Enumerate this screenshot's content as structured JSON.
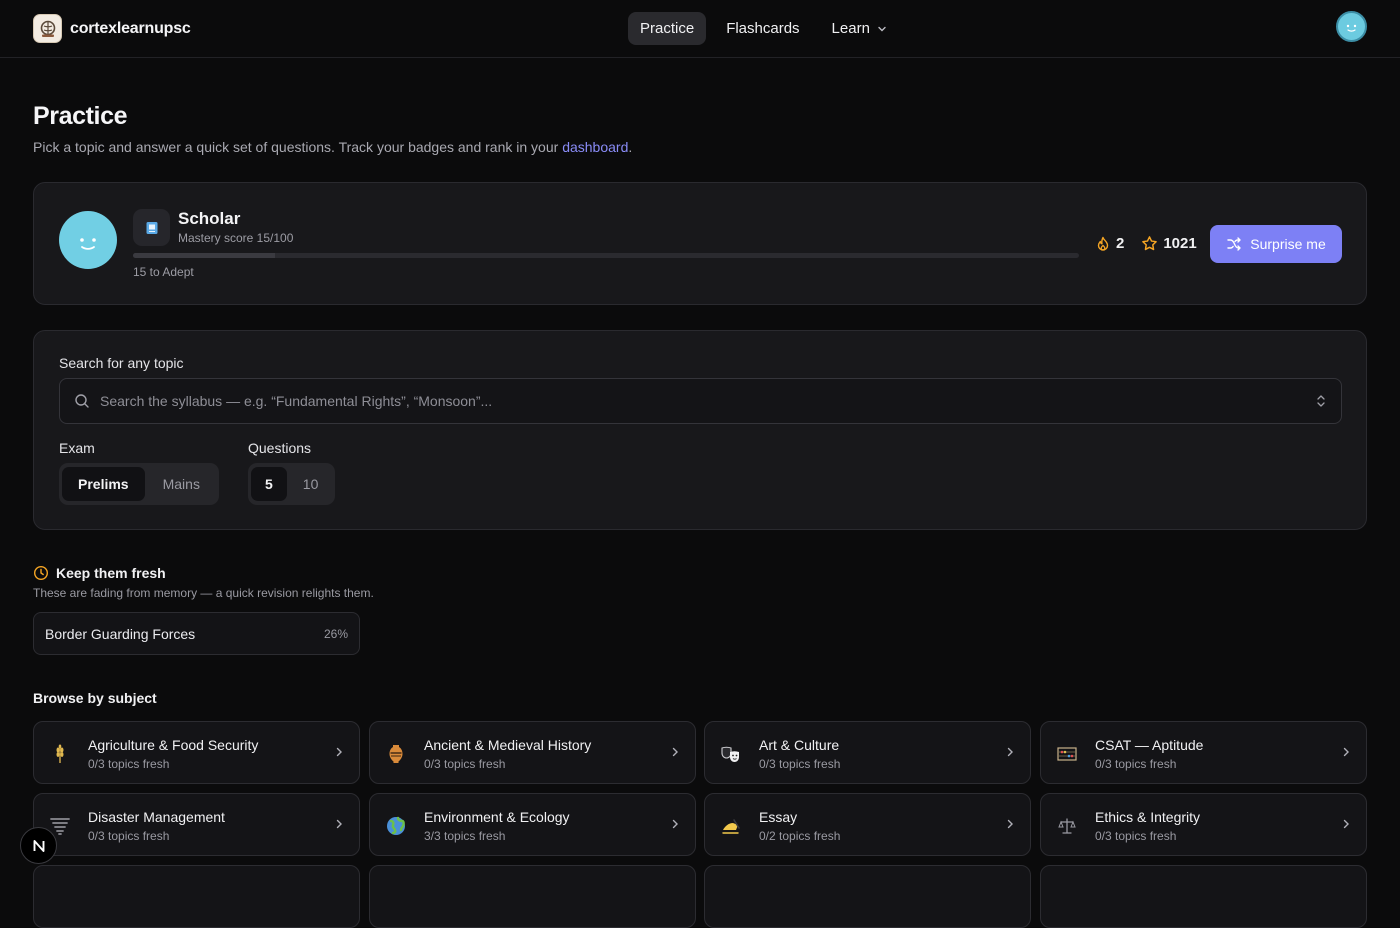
{
  "brand": {
    "name": "cortexlearnupsc"
  },
  "nav": {
    "items": [
      {
        "label": "Practice",
        "active": true
      },
      {
        "label": "Flashcards",
        "active": false
      },
      {
        "label": "Learn",
        "active": false
      }
    ]
  },
  "header": {
    "title": "Practice",
    "subtitle": "Pick a topic and answer a quick set of questions. Track your badges and rank in your ",
    "subtitle_link": "dashboard",
    "subtitle_end": "."
  },
  "profile": {
    "rank": "Scholar",
    "mastery": "Mastery score 15/100",
    "mastery_progress": 0.15,
    "next": "15 to Adept",
    "streak": "2",
    "stars": "1021",
    "surprise_label": "Surprise me"
  },
  "search": {
    "label": "Search for any topic",
    "placeholder": "Search the syllabus — e.g. “Fundamental Rights”, “Monsoon”..."
  },
  "exam": {
    "label": "Exam",
    "options": [
      "Prelims",
      "Mains"
    ],
    "selected": "Prelims"
  },
  "questions": {
    "label": "Questions",
    "options": [
      "5",
      "10"
    ],
    "selected": "5"
  },
  "fresh": {
    "title": "Keep them fresh",
    "subtitle": "These are fading from memory — a quick revision relights them.",
    "items": [
      {
        "name": "Border Guarding Forces",
        "pct": "26%"
      }
    ]
  },
  "browse": {
    "title": "Browse by subject",
    "subjects": [
      {
        "title": "Agriculture & Food Security",
        "sub": "0/3 topics fresh",
        "icon": "wheat-icon"
      },
      {
        "title": "Ancient & Medieval History",
        "sub": "0/3 topics fresh",
        "icon": "amphora-icon"
      },
      {
        "title": "Art & Culture",
        "sub": "0/3 topics fresh",
        "icon": "theatre-masks-icon"
      },
      {
        "title": "CSAT — Aptitude",
        "sub": "0/3 topics fresh",
        "icon": "abacus-icon"
      },
      {
        "title": "Disaster Management",
        "sub": "0/3 topics fresh",
        "icon": "tornado-icon"
      },
      {
        "title": "Environment & Ecology",
        "sub": "3/3 topics fresh",
        "icon": "globe-icon"
      },
      {
        "title": "Essay",
        "sub": "0/2 topics fresh",
        "icon": "writing-hand-icon"
      },
      {
        "title": "Ethics & Integrity",
        "sub": "0/3 topics fresh",
        "icon": "scales-icon"
      }
    ]
  },
  "colors": {
    "accent": "#7d80f5",
    "link": "#8a8cf7",
    "streak": "#f5a524",
    "star": "#f5a524",
    "background": "#0b0b0c"
  }
}
